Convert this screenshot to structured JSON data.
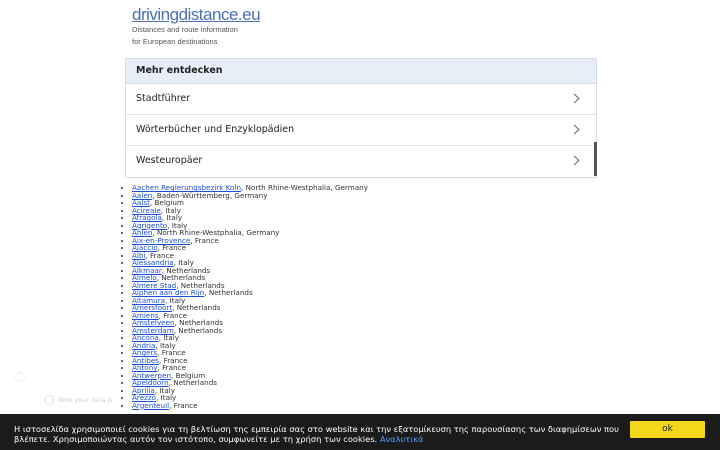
{
  "logo": {
    "title": "drivingdistance.eu",
    "subtitle_line1": "Distances and route information",
    "subtitle_line2": "for European destinations"
  },
  "discover": {
    "header": "Mehr entdecken",
    "items": [
      {
        "label": "Stadtführer"
      },
      {
        "label": "Wörterbücher und Enzyklopädien"
      },
      {
        "label": "Westeuropäer"
      }
    ]
  },
  "cities": [
    {
      "name": "Aachen Regierungsbezirk Koln",
      "region": ", North Rhine-Westphalia, Germany"
    },
    {
      "name": "Aalen",
      "region": ", Baden-Württemberg, Germany"
    },
    {
      "name": "Aalst",
      "region": ", Belgium"
    },
    {
      "name": "Acireale",
      "region": ", Italy"
    },
    {
      "name": "Afragola",
      "region": ", Italy"
    },
    {
      "name": "Agrigento",
      "region": ", Italy"
    },
    {
      "name": "Ahlen",
      "region": ", North Rhine-Westphalia, Germany"
    },
    {
      "name": "Aix-en-Provence",
      "region": ", France"
    },
    {
      "name": "Ajaccio",
      "region": ", France"
    },
    {
      "name": "Albi",
      "region": ", France"
    },
    {
      "name": "Alessandria",
      "region": ", Italy"
    },
    {
      "name": "Alkmaar",
      "region": ", Netherlands"
    },
    {
      "name": "Almelo",
      "region": ", Netherlands"
    },
    {
      "name": "Almere Stad",
      "region": ", Netherlands"
    },
    {
      "name": "Alphen aan den Rijn",
      "region": ", Netherlands"
    },
    {
      "name": "Altamura",
      "region": ", Italy"
    },
    {
      "name": "Amersfoort",
      "region": ", Netherlands"
    },
    {
      "name": "Amiens",
      "region": ", France"
    },
    {
      "name": "Amstelveen",
      "region": ", Netherlands"
    },
    {
      "name": "Amsterdam",
      "region": ", Netherlands"
    },
    {
      "name": "Ancona",
      "region": ", Italy"
    },
    {
      "name": "Andria",
      "region": ", Italy"
    },
    {
      "name": "Angers",
      "region": ", France"
    },
    {
      "name": "Antibes",
      "region": ", France"
    },
    {
      "name": "Antony",
      "region": ", France"
    },
    {
      "name": "Antwerpen",
      "region": ", Belgium"
    },
    {
      "name": "Apeldoorn",
      "region": ", Netherlands"
    },
    {
      "name": "Aprilia",
      "region": ", Italy"
    },
    {
      "name": "Arezzo",
      "region": ", Italy"
    },
    {
      "name": "Argenteuil",
      "region": ", France"
    }
  ],
  "cookie": {
    "text": "Η ιστοσελίδα χρησιμοποιεί cookies για τη βελτίωση της εμπειρία σας στο website και την εξατομίκευση της παρουσίασης των διαφημίσεων που βλέπετε. Χρησιμοποιώντας αυτόν τον ιστότοπο, συμφωνείτε με τη χρήση των cookies.",
    "link_label": "Αναλυτικά",
    "ok_label": "ok"
  },
  "ghost": {
    "text": "Now your data is"
  }
}
